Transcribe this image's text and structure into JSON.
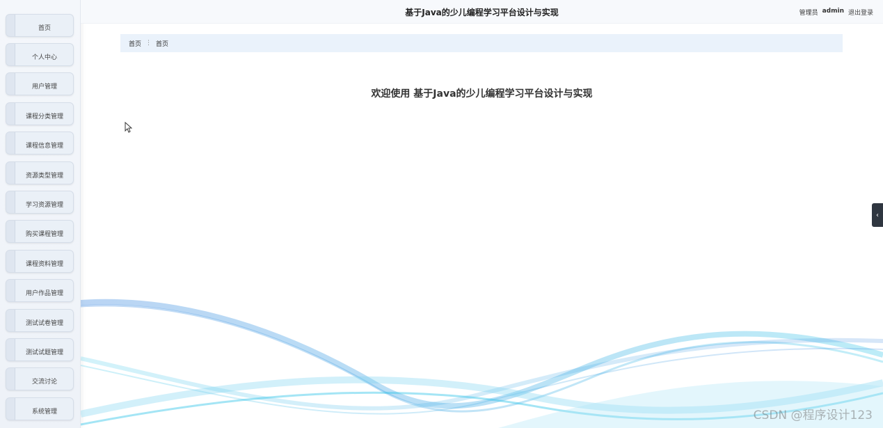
{
  "header": {
    "title": "基于Java的少儿编程学习平台设计与实现",
    "role": "管理员",
    "username": "admin",
    "logout_label": "退出登录"
  },
  "sidebar": {
    "items": [
      {
        "label": "首页"
      },
      {
        "label": "个人中心"
      },
      {
        "label": "用户管理"
      },
      {
        "label": "课程分类管理"
      },
      {
        "label": "课程信息管理"
      },
      {
        "label": "资源类型管理"
      },
      {
        "label": "学习资源管理"
      },
      {
        "label": "购买课程管理"
      },
      {
        "label": "课程资料管理"
      },
      {
        "label": "用户作品管理"
      },
      {
        "label": "测试试卷管理"
      },
      {
        "label": "测试试题管理"
      },
      {
        "label": "交流讨论"
      },
      {
        "label": "系统管理"
      }
    ]
  },
  "breadcrumb": {
    "root": "首页",
    "separator": "⋮",
    "current": "首页"
  },
  "main": {
    "welcome": "欢迎使用 基于Java的少儿编程学习平台设计与实现"
  },
  "collapse_tab": {
    "icon": "chevron-left-icon",
    "glyph": "‹"
  },
  "watermark": "CSDN @程序设计123",
  "colors": {
    "wave_blue": "#4a90e2",
    "wave_cyan": "#36c6e8",
    "breadcrumb_bg": "#eaf2fb"
  }
}
